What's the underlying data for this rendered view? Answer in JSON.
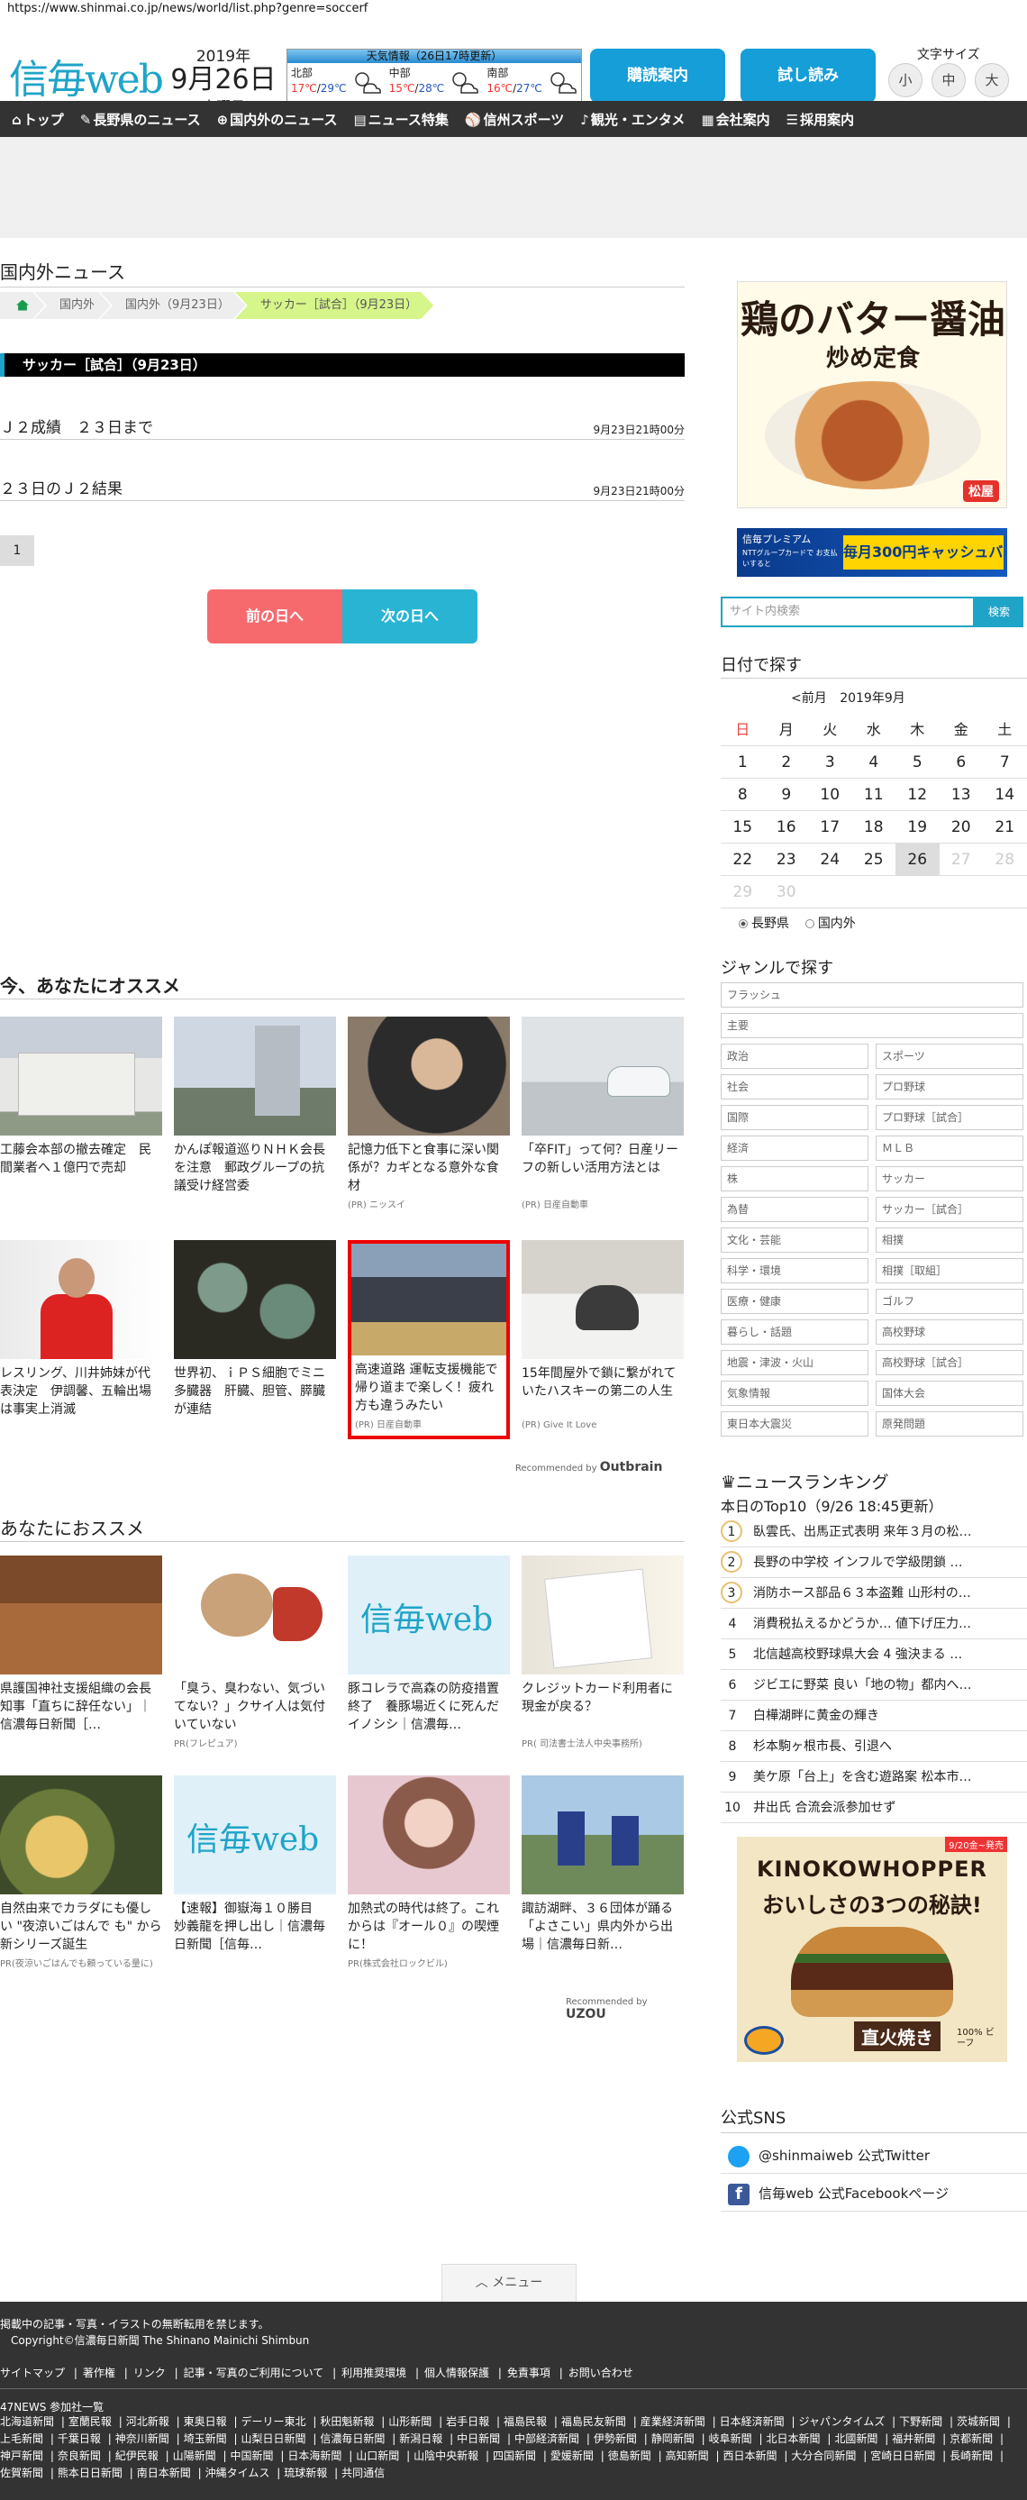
{
  "browser": {
    "url": "https://www.shinmai.co.jp/news/world/list.php?genre=soccerf"
  },
  "header": {
    "logo": "信毎web",
    "year": "2019年",
    "date": "9月26日",
    "weekday": "木曜日",
    "weather": {
      "title": "天気情報（26日17時更新）",
      "regions": [
        {
          "name": "北部",
          "hi": "17℃",
          "lo": "29℃"
        },
        {
          "name": "中部",
          "hi": "15℃",
          "lo": "28℃"
        },
        {
          "name": "南部",
          "hi": "16℃",
          "lo": "27℃"
        }
      ]
    },
    "subscribe_label": "購読案内",
    "trial_label": "試し読み",
    "font_size_label": "文字サイズ",
    "font_sizes": [
      "小",
      "中",
      "大"
    ]
  },
  "nav": [
    {
      "icon": "home-icon",
      "label": "トップ"
    },
    {
      "icon": "pen-icon",
      "label": "長野県のニュース"
    },
    {
      "icon": "globe-icon",
      "label": "国内外のニュース"
    },
    {
      "icon": "doc-icon",
      "label": "ニュース特集"
    },
    {
      "icon": "ball-icon",
      "label": "信州スポーツ"
    },
    {
      "icon": "music-icon",
      "label": "観光・エンタメ"
    },
    {
      "icon": "building-icon",
      "label": "会社案内"
    },
    {
      "icon": "list-icon",
      "label": "採用案内"
    }
  ],
  "main": {
    "section_title": "国内外ニュース",
    "breadcrumbs": [
      "国内外",
      "国内外（9月23日）",
      "サッカー［試合］（9月23日）"
    ],
    "category_title": "サッカー［試合］（9月23日）",
    "articles": [
      {
        "title": "Ｊ２成績　２３日まで",
        "date": "9月23日21時00分"
      },
      {
        "title": "２３日のＪ２結果",
        "date": "9月23日21時00分"
      }
    ],
    "page": "1",
    "prev_day": "前の日へ",
    "next_day": "次の日へ"
  },
  "reco1": {
    "heading": "今、あなたにオススメ",
    "cards": [
      {
        "title": "工藤会本部の撤去確定　民間業者へ１億円で売却",
        "pr": ""
      },
      {
        "title": "かんぽ報道巡りＮＨＫ会長を注意　郵政グループの抗議受け経営委",
        "pr": ""
      },
      {
        "title": "記憶力低下と食事に深い関係が？カギとなる意外な食材",
        "pr": "(PR) ニッスイ"
      },
      {
        "title": "「卒FIT」って何？日産リーフの新しい活用方法とは",
        "pr": "(PR) 日産自動車"
      },
      {
        "title": "レスリング、川井姉妹が代表決定　伊調馨、五輪出場は事実上消滅",
        "pr": ""
      },
      {
        "title": "世界初、ｉＰＳ細胞でミニ多臓器　肝臓、胆管、膵臓が連結",
        "pr": ""
      },
      {
        "title": "高速道路 運転支援機能で帰り道まで楽しく！疲れ方も違うみたい",
        "pr": "(PR) 日産自動車"
      },
      {
        "title": "15年間屋外で鎖に繋がれていたハスキーの第二の人生",
        "pr": "(PR) Give It Love"
      }
    ],
    "recommended_by": "Recommended by",
    "vendor": "Outbrain"
  },
  "reco2": {
    "heading": "あなたにおススメ",
    "cards": [
      {
        "title": "県護国神社支援組織の会長　知事「直ちに辞任ない」｜信濃毎日新聞［…",
        "pr": ""
      },
      {
        "title": "「臭う、臭わない、気づいてない？」クサイ人は気付いていない",
        "pr": "PR(フレピュア)"
      },
      {
        "title": "豚コレラで高森の防疫措置終了　養豚場近くに死んだイノシシ｜信濃毎…",
        "pr": ""
      },
      {
        "title": "クレジットカード利用者に現金が戻る？",
        "pr": "PR( 司法書士法人中央事務所)"
      },
      {
        "title": "自然由来でカラダにも優しい \"夜涼いごはんで も\" から新シリーズ誕生",
        "pr": "PR(夜涼いごはんでも頼っている量に)"
      },
      {
        "title": "【速報】御嶽海１０勝目　妙義龍を押し出し｜信濃毎日新聞［信毎…",
        "pr": ""
      },
      {
        "title": "加熱式の時代は終了。これからは『オール０』の喫煙に！",
        "pr": "PR(株式会社ロックビル)"
      },
      {
        "title": "諏訪湖畔、３６団体が踊る　「よさこい」県内外から出場｜信濃毎日新…",
        "pr": ""
      }
    ],
    "recommended_by": "Recommended by",
    "vendor": "UZOU"
  },
  "sidebar": {
    "ad1": {
      "headline": "鶏のバター醤油",
      "sub": "炒め定食",
      "brand": "松屋"
    },
    "ad2": {
      "left": "信毎プレミアム",
      "mid": "NTTグループカードで お支払いすると",
      "right": "毎月300円キャッシュバック"
    },
    "search_placeholder": "サイト内検索",
    "search_button": "検索",
    "calendar": {
      "heading": "日付で探す",
      "prev": "<前月",
      "month": "2019年9月",
      "weekdays": [
        "日",
        "月",
        "火",
        "水",
        "木",
        "金",
        "土"
      ],
      "weeks": [
        [
          "1",
          "2",
          "3",
          "4",
          "5",
          "6",
          "7"
        ],
        [
          "8",
          "9",
          "10",
          "11",
          "12",
          "13",
          "14"
        ],
        [
          "15",
          "16",
          "17",
          "18",
          "19",
          "20",
          "21"
        ],
        [
          "22",
          "23",
          "24",
          "25",
          "26",
          "27",
          "28"
        ],
        [
          "29",
          "30",
          "",
          "",
          "",
          "",
          ""
        ]
      ],
      "today": "26",
      "radio_nagano": "長野県",
      "radio_world": "国内外"
    },
    "genre": {
      "heading": "ジャンルで探す",
      "top": [
        "フラッシュ",
        "主要"
      ],
      "pairs": [
        [
          "政治",
          "スポーツ"
        ],
        [
          "社会",
          "プロ野球"
        ],
        [
          "国際",
          "プロ野球［試合］"
        ],
        [
          "経済",
          "ＭＬＢ"
        ],
        [
          "株",
          "サッカー"
        ],
        [
          "為替",
          "サッカー［試合］"
        ],
        [
          "文化・芸能",
          "相撲"
        ],
        [
          "科学・環境",
          "相撲［取組］"
        ],
        [
          "医療・健康",
          "ゴルフ"
        ],
        [
          "暮らし・話題",
          "高校野球"
        ],
        [
          "地震・津波・火山",
          "高校野球［試合］"
        ],
        [
          "気象情報",
          "国体大会"
        ],
        [
          "東日本大震災",
          "原発問題"
        ]
      ]
    },
    "ranking": {
      "heading": "ニュースランキング",
      "sub": "本日のTop10（9/26 18:45更新）",
      "items": [
        "臥雲氏、出馬正式表明 来年３月の松…",
        "長野の中学校 インフルで学級閉鎖 …",
        "消防ホース部品６３本盗難 山形村の…",
        "消費税払えるかどうか… 値下げ圧力…",
        "北信越高校野球県大会 4 強決まる …",
        "ジビエに野菜 良い「地の物」都内へ…",
        "白樺湖畔に黄金の輝き",
        "杉本駒ヶ根市長、引退へ",
        "美ケ原「台上」を含む遊路案 松本市…",
        "井出氏 合流会派参加せず"
      ]
    },
    "ad3": {
      "brand": "KINOKOWHOPPER",
      "headline": "おいしさの3つの秘訣!",
      "badge": "9/20金~発売",
      "bottom": "直火焼き",
      "tag": "100% ビーフ"
    },
    "sns": {
      "heading": "公式SNS",
      "twitter": "@shinmaiweb 公式Twitter",
      "facebook": "信毎web 公式Facebookページ"
    }
  },
  "menu_label": "メニュー",
  "footer": {
    "notice": "掲載中の記事・写真・イラストの無断転用を禁じます。",
    "copyright": "Copyright©信濃毎日新聞 The Shinano Mainichi Shimbun",
    "links": [
      "サイトマップ",
      "著作権",
      "リンク",
      "記事・写真のご利用について",
      "利用推奨環境",
      "個人情報保護",
      "免責事項",
      "お問い合わせ"
    ],
    "network_label": "47NEWS 参加社一覧",
    "papers": [
      "北海道新聞",
      "室蘭民報",
      "河北新報",
      "東奥日報",
      "デーリー東北",
      "秋田魁新報",
      "山形新聞",
      "岩手日報",
      "福島民報",
      "福島民友新聞",
      "産業経済新聞",
      "日本経済新聞",
      "ジャパンタイムズ",
      "下野新聞",
      "茨城新聞",
      "上毛新聞",
      "千葉日報",
      "神奈川新聞",
      "埼玉新聞",
      "山梨日日新聞",
      "信濃毎日新聞",
      "新潟日報",
      "中日新聞",
      "中部経済新聞",
      "伊勢新聞",
      "静岡新聞",
      "岐阜新聞",
      "北日本新聞",
      "北國新聞",
      "福井新聞",
      "京都新聞",
      "神戸新聞",
      "奈良新聞",
      "紀伊民報",
      "山陽新聞",
      "中国新聞",
      "日本海新聞",
      "山口新聞",
      "山陰中央新報",
      "四国新聞",
      "愛媛新聞",
      "徳島新聞",
      "高知新聞",
      "西日本新聞",
      "大分合同新聞",
      "宮崎日日新聞",
      "長崎新聞",
      "佐賀新聞",
      "熊本日日新聞",
      "南日本新聞",
      "沖縄タイムス",
      "琉球新報",
      "共同通信"
    ]
  }
}
